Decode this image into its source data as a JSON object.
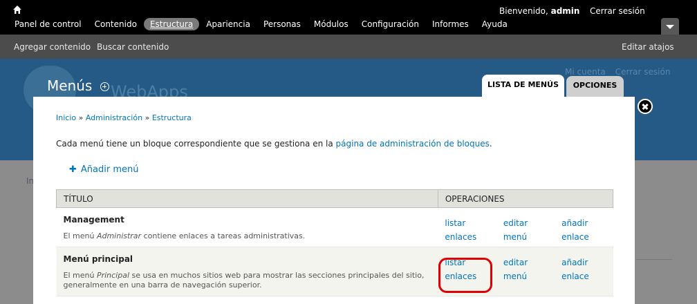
{
  "toolbar": {
    "welcome_prefix": "Bienvenido,",
    "username": "admin",
    "logout": "Cerrar sesión",
    "nav": [
      {
        "label": "Panel de control"
      },
      {
        "label": "Contenido"
      },
      {
        "label": "Estructura",
        "active": true
      },
      {
        "label": "Apariencia"
      },
      {
        "label": "Personas"
      },
      {
        "label": "Módulos"
      },
      {
        "label": "Configuración"
      },
      {
        "label": "Informes"
      },
      {
        "label": "Ayuda"
      }
    ]
  },
  "shortcuts": {
    "add_content": "Agregar contenido",
    "find_content": "Buscar contenido",
    "edit_shortcuts": "Editar atajos"
  },
  "site": {
    "name": "WebApps",
    "my_account": "Mi cuenta",
    "logout": "Cerrar sesión",
    "breadcrumb_fragment": "In"
  },
  "overlay": {
    "title": "Menús",
    "tabs": {
      "list": "LISTA DE MENÚS",
      "options": "OPCIONES"
    },
    "breadcrumb": {
      "items": [
        "Inicio",
        "Administración",
        "Estructura"
      ],
      "separator": " » "
    },
    "description_prefix": "Cada menú tiene un bloque correspondiente que se gestiona en la ",
    "description_link": "página de administración de bloques",
    "description_suffix": ".",
    "add_menu": "Añadir menú",
    "table": {
      "headers": {
        "title": "TÍTULO",
        "operations": "OPERACIONES"
      },
      "rows": [
        {
          "name": "Management",
          "desc_before": "El menú ",
          "desc_em": "Administrar",
          "desc_after": " contiene enlaces a tareas administrativas.",
          "ops": [
            "listar enlaces",
            "editar menú",
            "añadir enlace"
          ]
        },
        {
          "name": "Menú principal",
          "desc_before": "El menú ",
          "desc_em": "Principal",
          "desc_after": " se usa en muchos sitios web para mostrar las secciones principales del sitio, generalmente en una barra de navegación superior.",
          "ops": [
            "listar enlaces",
            "editar menú",
            "añadir enlace"
          ]
        }
      ]
    }
  },
  "colors": {
    "link": "#0074bd",
    "highlight": "#e00000",
    "toolbar_bg": "#000000",
    "shortcuts_bg": "#4c4c4c"
  }
}
